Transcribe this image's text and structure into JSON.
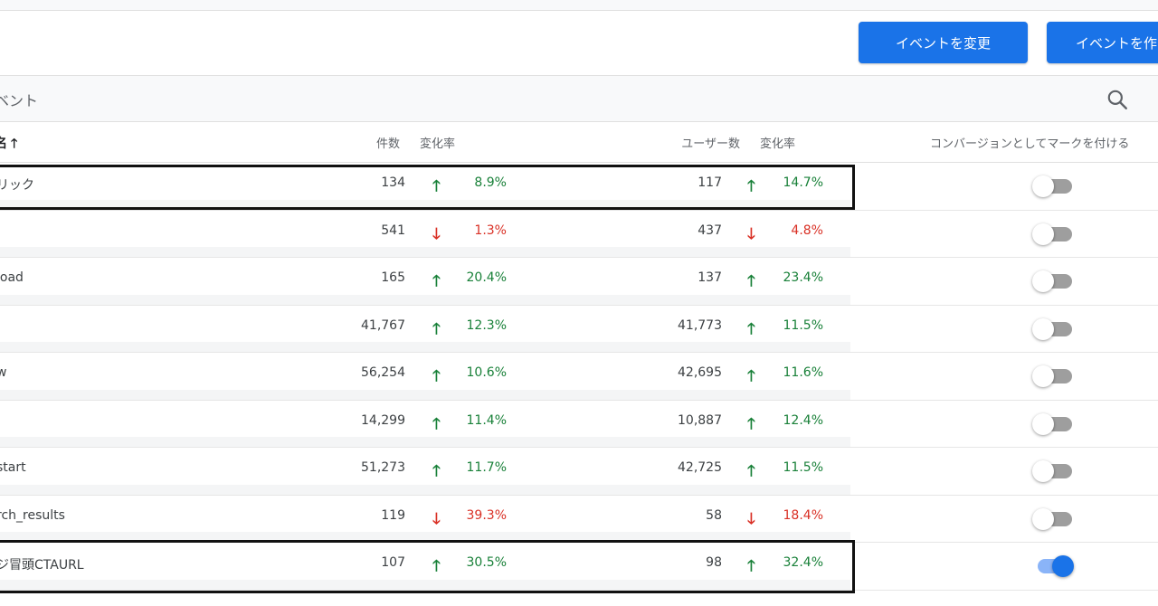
{
  "toolbar": {
    "change_event_label": "イベントを変更",
    "create_event_label": "イベントを作"
  },
  "section": {
    "title": "ベント"
  },
  "table": {
    "headers": {
      "name": "名",
      "count": "件数",
      "count_change": "変化率",
      "users": "ユーザー数",
      "users_change": "変化率",
      "conversion": "コンバージョンとしてマークを付ける"
    },
    "rows": [
      {
        "name": "リック",
        "count": "134",
        "count_dir": "up",
        "count_pct": "8.9%",
        "users": "117",
        "users_dir": "up",
        "users_pct": "14.7%",
        "conversion": false
      },
      {
        "name": "",
        "count": "541",
        "count_dir": "down",
        "count_pct": "1.3%",
        "users": "437",
        "users_dir": "down",
        "users_pct": "4.8%",
        "conversion": false
      },
      {
        "name": "load",
        "count": "165",
        "count_dir": "up",
        "count_pct": "20.4%",
        "users": "137",
        "users_dir": "up",
        "users_pct": "23.4%",
        "conversion": false
      },
      {
        "name": "",
        "count": "41,767",
        "count_dir": "up",
        "count_pct": "12.3%",
        "users": "41,773",
        "users_dir": "up",
        "users_pct": "11.5%",
        "conversion": false
      },
      {
        "name": "w",
        "count": "56,254",
        "count_dir": "up",
        "count_pct": "10.6%",
        "users": "42,695",
        "users_dir": "up",
        "users_pct": "11.6%",
        "conversion": false
      },
      {
        "name": "",
        "count": "14,299",
        "count_dir": "up",
        "count_pct": "11.4%",
        "users": "10,887",
        "users_dir": "up",
        "users_pct": "12.4%",
        "conversion": false
      },
      {
        "name": "start",
        "count": "51,273",
        "count_dir": "up",
        "count_pct": "11.7%",
        "users": "42,725",
        "users_dir": "up",
        "users_pct": "11.5%",
        "conversion": false
      },
      {
        "name": "rch_results",
        "count": "119",
        "count_dir": "down",
        "count_pct": "39.3%",
        "users": "58",
        "users_dir": "down",
        "users_pct": "18.4%",
        "conversion": false
      },
      {
        "name": "ジ冒頭CTAURL",
        "count": "107",
        "count_dir": "up",
        "count_pct": "30.5%",
        "users": "98",
        "users_dir": "up",
        "users_pct": "32.4%",
        "conversion": true
      }
    ]
  },
  "colors": {
    "primary": "#1a73e8",
    "up": "#188038",
    "down": "#d93025",
    "toggle_off": "#9e9e9e",
    "toggle_on_track": "#8ab4f8"
  },
  "icons": {
    "search": "search-icon",
    "sort": "arrow-up-icon",
    "trend_up": "arrow-up-icon",
    "trend_down": "arrow-down-icon"
  }
}
